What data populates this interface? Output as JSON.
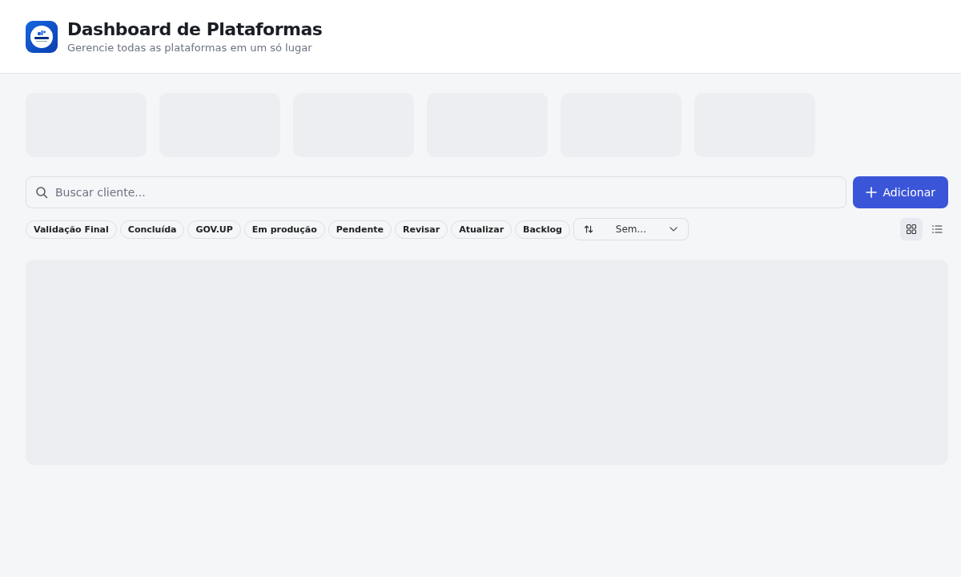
{
  "header": {
    "title": "Dashboard de Plataformas",
    "subtitle": "Gerencie todas as plataformas em um só lugar"
  },
  "search": {
    "placeholder": "Buscar cliente..."
  },
  "add_button": {
    "label": "Adicionar"
  },
  "filters": [
    {
      "label": "Validação Final",
      "selected": false
    },
    {
      "label": "Concluída",
      "selected": false
    },
    {
      "label": "GOV.UP",
      "selected": false
    },
    {
      "label": "Em produção",
      "selected": false
    },
    {
      "label": "Pendente",
      "selected": false
    },
    {
      "label": "Revisar",
      "selected": false
    },
    {
      "label": "Atualizar",
      "selected": false
    },
    {
      "label": "Backlog",
      "selected": false
    }
  ],
  "sort": {
    "value": "Sem..."
  },
  "views": [
    {
      "kind": "grid",
      "selected": true
    },
    {
      "kind": "list",
      "selected": false
    }
  ]
}
